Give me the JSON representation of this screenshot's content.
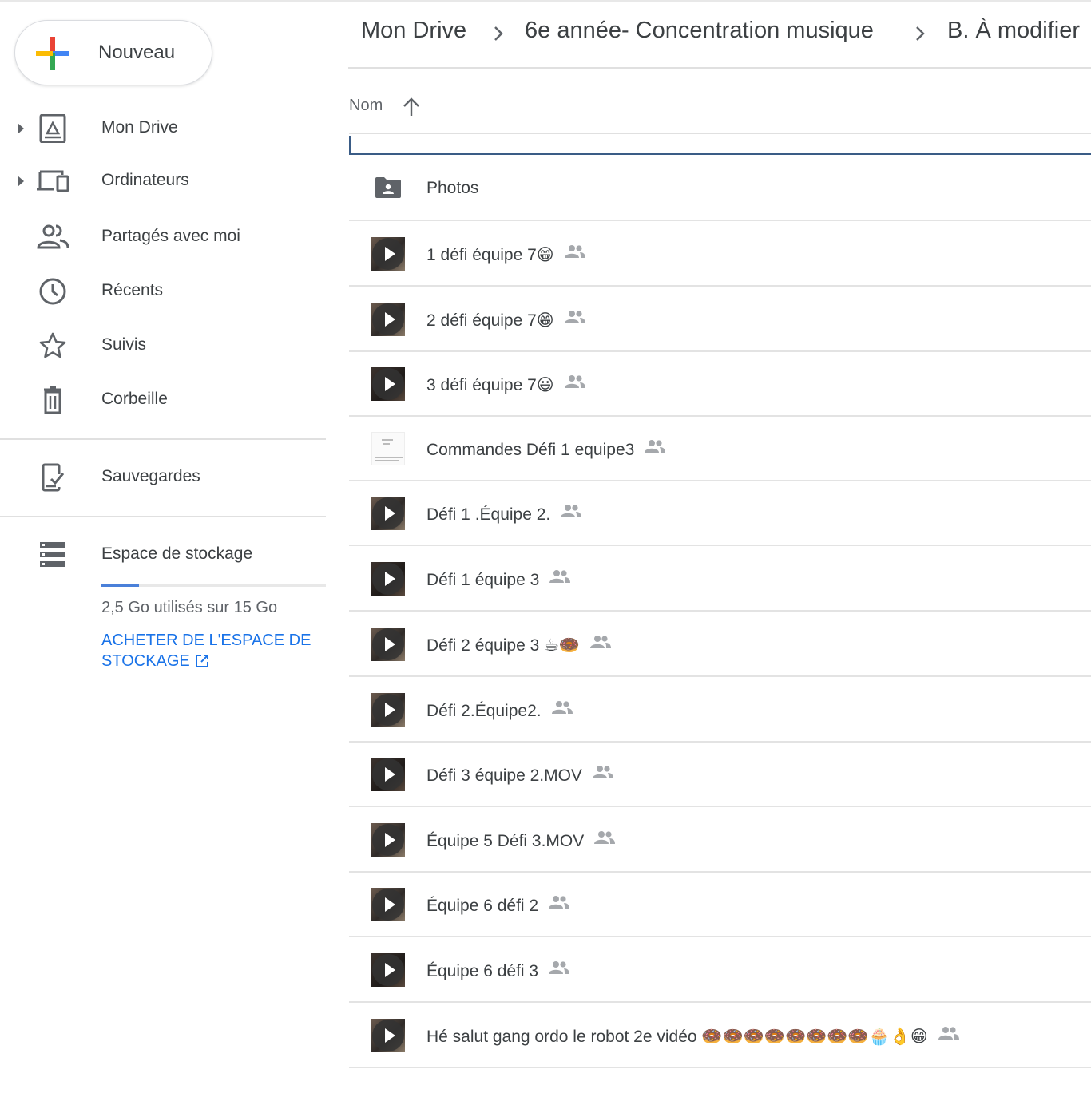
{
  "app": {
    "new_button_label": "Nouveau"
  },
  "sidebar": {
    "items": [
      {
        "label": "Mon Drive",
        "icon": "drive-icon",
        "expandable": true
      },
      {
        "label": "Ordinateurs",
        "icon": "computers-icon",
        "expandable": true
      },
      {
        "label": "Partagés avec moi",
        "icon": "shared-with-me-icon",
        "expandable": false
      },
      {
        "label": "Récents",
        "icon": "clock-icon",
        "expandable": false
      },
      {
        "label": "Suivis",
        "icon": "star-icon",
        "expandable": false
      },
      {
        "label": "Corbeille",
        "icon": "trash-icon",
        "expandable": false
      },
      {
        "label": "Sauvegardes",
        "icon": "backup-icon",
        "expandable": false
      },
      {
        "label": "Espace de stockage",
        "icon": "storage-icon",
        "expandable": false
      }
    ],
    "storage": {
      "used_fraction": 0.167,
      "usage_text": "2,5 Go utilisés sur 15 Go",
      "buy_link_line1": "ACHETER DE L'ESPACE DE",
      "buy_link_line2": "STOCKAGE"
    }
  },
  "breadcrumb": {
    "items": [
      "Mon Drive",
      "6e année- Concentration musique",
      "B. À modifier"
    ]
  },
  "list": {
    "column_header": "Nom",
    "sort": "ascending",
    "rows": [
      {
        "name": "Photos",
        "type": "folder",
        "shared": false
      },
      {
        "name": "1 défi équipe 7😁",
        "type": "video",
        "shared": true
      },
      {
        "name": "2 défi équipe 7😁",
        "type": "video",
        "shared": true
      },
      {
        "name": "3 défi équipe 7😃",
        "type": "video",
        "shared": true
      },
      {
        "name": "Commandes Défi 1 equipe3",
        "type": "image",
        "shared": true
      },
      {
        "name": "Défi 1 .Équipe 2.",
        "type": "video",
        "shared": true
      },
      {
        "name": "Défi 1 équipe 3",
        "type": "video",
        "shared": true
      },
      {
        "name": "Défi 2 équipe 3 ☕🍩",
        "type": "video",
        "shared": true
      },
      {
        "name": "Défi 2.Équipe2.",
        "type": "video",
        "shared": true
      },
      {
        "name": "Défi 3 équipe 2.MOV",
        "type": "video",
        "shared": true
      },
      {
        "name": "Équipe 5 Défi 3.MOV",
        "type": "video",
        "shared": true
      },
      {
        "name": "Équipe 6 défi 2",
        "type": "video",
        "shared": true
      },
      {
        "name": "Équipe 6 défi 3",
        "type": "video",
        "shared": true
      },
      {
        "name": "Hé salut gang ordo le robot 2e vidéo 🍩🍩🍩🍩🍩🍩🍩🍩🧁👌😁",
        "type": "video",
        "shared": true
      }
    ]
  },
  "colors": {
    "accent": "#1a73e8",
    "storage_fill": "#4a80d9",
    "text": "#3c4043",
    "icon": "#5f6368",
    "focus": "#3a5c86"
  }
}
